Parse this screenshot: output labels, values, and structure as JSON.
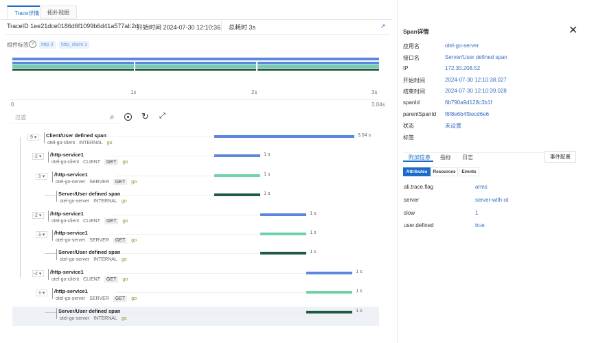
{
  "tabs": [
    {
      "label": "Trace详情",
      "active": true
    },
    {
      "label": "拓扑视图",
      "active": false
    }
  ],
  "info": {
    "trace_id": "TraceID 1ee21dce0186d6f1099b6d41a577ab2d",
    "start": "开始时间 2024-07-30 12:10:36",
    "total": "总耗时 3s",
    "export_icon": "external-link-icon"
  },
  "tags": {
    "label": "组件标签",
    "help_icon": "question-circle-icon",
    "items": [
      "http 3",
      "http_client 3"
    ]
  },
  "axis": {
    "ticks": [
      "1s",
      "2s",
      "3s"
    ],
    "start": "0",
    "end": "3.04s"
  },
  "filter": {
    "placeholder": "过滤",
    "icons": [
      "search-icon",
      "locate-icon",
      "refresh-icon",
      "expand-icon"
    ]
  },
  "colors": {
    "client": "#5b88dd",
    "server": "#6fd2a6",
    "internal": "#1e5a45",
    "accent": "#1c6cc9"
  },
  "spans": [
    {
      "depth": 0,
      "count": "9",
      "name": "Client/User defined span",
      "service": "otel-go-client",
      "kind": "INTERNAL",
      "method": "",
      "lang": "go",
      "start": 0,
      "duration": 3.04,
      "type": "client",
      "label": "3.04 s"
    },
    {
      "depth": 1,
      "count": "2",
      "name": "/http-service1",
      "service": "otel-go-client",
      "kind": "CLIENT",
      "method": "GET",
      "lang": "go",
      "start": 0,
      "duration": 1,
      "type": "client",
      "label": "1 s"
    },
    {
      "depth": 2,
      "count": "1",
      "name": "/http-service1",
      "service": "otel-go-server",
      "kind": "SERVER",
      "method": "GET",
      "lang": "go",
      "start": 0,
      "duration": 1,
      "type": "server",
      "label": "1 s"
    },
    {
      "depth": 3,
      "count": "",
      "name": "Server/User defined span",
      "service": "otel-go-server",
      "kind": "INTERNAL",
      "method": "",
      "lang": "go",
      "start": 0,
      "duration": 1,
      "type": "internal",
      "label": "1 s"
    },
    {
      "depth": 1,
      "count": "2",
      "name": "/http-service1",
      "service": "otel-go-client",
      "kind": "CLIENT",
      "method": "GET",
      "lang": "go",
      "start": 1,
      "duration": 1,
      "type": "client",
      "label": "1 s"
    },
    {
      "depth": 2,
      "count": "1",
      "name": "/http-service1",
      "service": "otel-go-server",
      "kind": "SERVER",
      "method": "GET",
      "lang": "go",
      "start": 1,
      "duration": 1,
      "type": "server",
      "label": "1 s"
    },
    {
      "depth": 3,
      "count": "",
      "name": "Server/User defined span",
      "service": "otel-go-server",
      "kind": "INTERNAL",
      "method": "",
      "lang": "go",
      "start": 1,
      "duration": 1,
      "type": "internal",
      "label": "1 s"
    },
    {
      "depth": 1,
      "count": "2",
      "name": "/http-service1",
      "service": "otel-go-client",
      "kind": "CLIENT",
      "method": "GET",
      "lang": "go",
      "start": 2,
      "duration": 1,
      "type": "client",
      "label": "1 s"
    },
    {
      "depth": 2,
      "count": "1",
      "name": "/http-service1",
      "service": "otel-go-server",
      "kind": "SERVER",
      "method": "GET",
      "lang": "go",
      "start": 2,
      "duration": 1,
      "type": "server",
      "label": "1 s"
    },
    {
      "depth": 3,
      "count": "",
      "name": "Server/User defined span",
      "service": "otel-go-server",
      "kind": "INTERNAL",
      "method": "",
      "lang": "go",
      "start": 2,
      "duration": 1,
      "type": "internal",
      "label": "1 s",
      "selected": true
    }
  ],
  "detail": {
    "title": "Span详情",
    "close_icon": "close-icon",
    "fields": [
      {
        "k": "应用名",
        "v": "otel-go-server"
      },
      {
        "k": "接口名",
        "v": "Server/User defined span"
      },
      {
        "k": "IP",
        "v": "172.30.208.52"
      },
      {
        "k": "开始时间",
        "v": "2024-07-30 12:10:38.027"
      },
      {
        "k": "结束时间",
        "v": "2024-07-30 12:10:39.028"
      },
      {
        "k": "spanId",
        "v": "6b790a9d128c3b1f"
      },
      {
        "k": "parentSpanId",
        "v": "f6f8e6b4f9ecd6e6"
      },
      {
        "k": "状态",
        "v": "未设置"
      },
      {
        "k": "标签",
        "v": ""
      }
    ],
    "tabs": [
      "附加信息",
      "指标",
      "日志"
    ],
    "event_config": "事件配置",
    "subtabs": [
      "Attributes",
      "Resources",
      "Events"
    ],
    "attributes": [
      {
        "k": "ali.trace.flag",
        "v": "arms"
      },
      {
        "k": "server",
        "v": "server-with-ot"
      },
      {
        "k": "slow",
        "v": "1"
      },
      {
        "k": "user.defined",
        "v": "true"
      }
    ]
  }
}
